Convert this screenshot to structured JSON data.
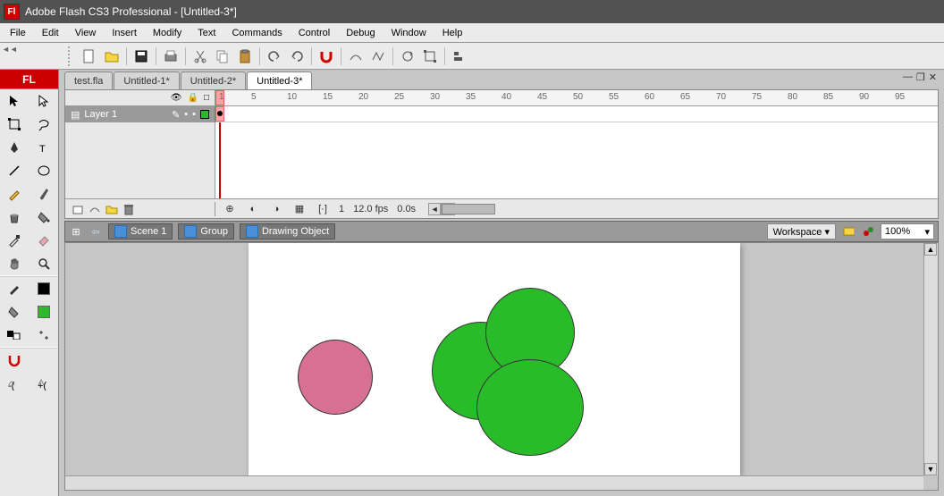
{
  "app": {
    "title": "Adobe Flash CS3 Professional - [Untitled-3*]",
    "icon_label": "Fl"
  },
  "menu": [
    "File",
    "Edit",
    "View",
    "Insert",
    "Modify",
    "Text",
    "Commands",
    "Control",
    "Debug",
    "Window",
    "Help"
  ],
  "tabs": {
    "items": [
      "test.fla",
      "Untitled-1*",
      "Untitled-2*",
      "Untitled-3*"
    ],
    "active_index": 3
  },
  "timeline": {
    "ruler_marks": [
      1,
      5,
      10,
      15,
      20,
      25,
      30,
      35,
      40,
      45,
      50,
      55,
      60,
      65,
      70,
      75,
      80,
      85,
      90,
      95
    ],
    "layer_name": "Layer 1",
    "frame_number": "1",
    "fps": "12.0 fps",
    "elapsed": "0.0s"
  },
  "edit_bar": {
    "scene": "Scene 1",
    "group": "Group",
    "drawing_object": "Drawing Object",
    "workspace_label": "Workspace ▾",
    "zoom": "100%"
  },
  "tools_panel_label": "FL",
  "shapes": {
    "pink_circle": {
      "color": "#d87093"
    },
    "green_circles": {
      "color": "#2abb2a"
    }
  }
}
